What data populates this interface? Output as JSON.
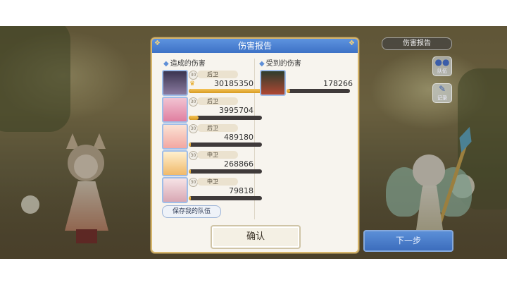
{
  "hud": {
    "report_label": "伤害报告",
    "team_label": "队伍",
    "log_label": "记录",
    "next_label": "下一步"
  },
  "dialog": {
    "title": "伤害报告",
    "dealt_title": "造成的伤害",
    "received_title": "受到的伤害",
    "save_label": "保存我的队伍",
    "confirm_label": "确认"
  },
  "dealt": [
    {
      "level": "30",
      "position": "后卫",
      "damage": "30185350",
      "bar_fraction": 1.0,
      "crown": true
    },
    {
      "level": "30",
      "position": "后卫",
      "damage": "3995704",
      "bar_fraction": 0.13,
      "crown": false
    },
    {
      "level": "30",
      "position": "后卫",
      "damage": "489180",
      "bar_fraction": 0.03,
      "crown": false
    },
    {
      "level": "30",
      "position": "中卫",
      "damage": "268866",
      "bar_fraction": 0.02,
      "crown": false
    },
    {
      "level": "30",
      "position": "中卫",
      "damage": "79818",
      "bar_fraction": 0.01,
      "crown": false
    }
  ],
  "received": [
    {
      "damage": "178266",
      "bar_fraction": 0.06
    }
  ],
  "colors": {
    "header_blue": "#4a80d2",
    "bar_gold": "#e3a93a",
    "frame_gold": "#d6b56a"
  }
}
